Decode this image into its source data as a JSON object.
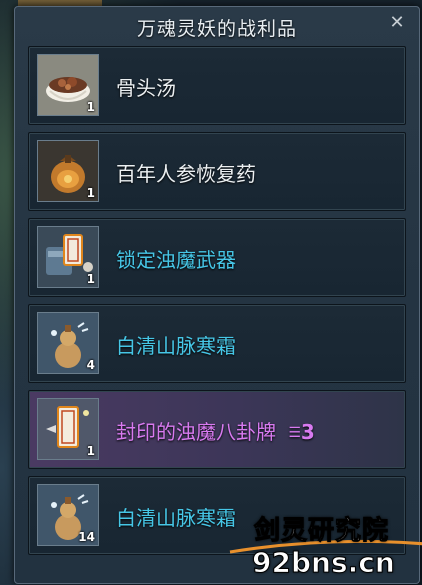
{
  "window": {
    "title": "万魂灵妖的战利品",
    "close_label": "✕"
  },
  "items": [
    {
      "name": "骨头汤",
      "qty": "1",
      "color": "white",
      "icon": "soup-bowl-icon"
    },
    {
      "name": "百年人参恢复药",
      "qty": "1",
      "color": "white",
      "icon": "potion-pouch-icon"
    },
    {
      "name": "锁定浊魔武器",
      "qty": "1",
      "color": "cyan",
      "icon": "weapon-chest-icon"
    },
    {
      "name": "白清山脉寒霜",
      "qty": "4",
      "color": "cyan",
      "icon": "frost-gourd-icon"
    },
    {
      "name": "封印的浊魔八卦牌",
      "qty": "1",
      "color": "purple",
      "icon": "bagua-card-icon",
      "tier": "3"
    },
    {
      "name": "白清山脉寒霜",
      "qty": "14",
      "color": "cyan",
      "icon": "frost-gourd-icon"
    }
  ],
  "watermark": {
    "line1": "剑灵研究院",
    "line2": "92bns.cn"
  },
  "colors": {
    "white_text": "#ecf0f2",
    "cyan_text": "#46c6e6",
    "purple_text": "#d87af0",
    "panel_bg": "#243442"
  }
}
